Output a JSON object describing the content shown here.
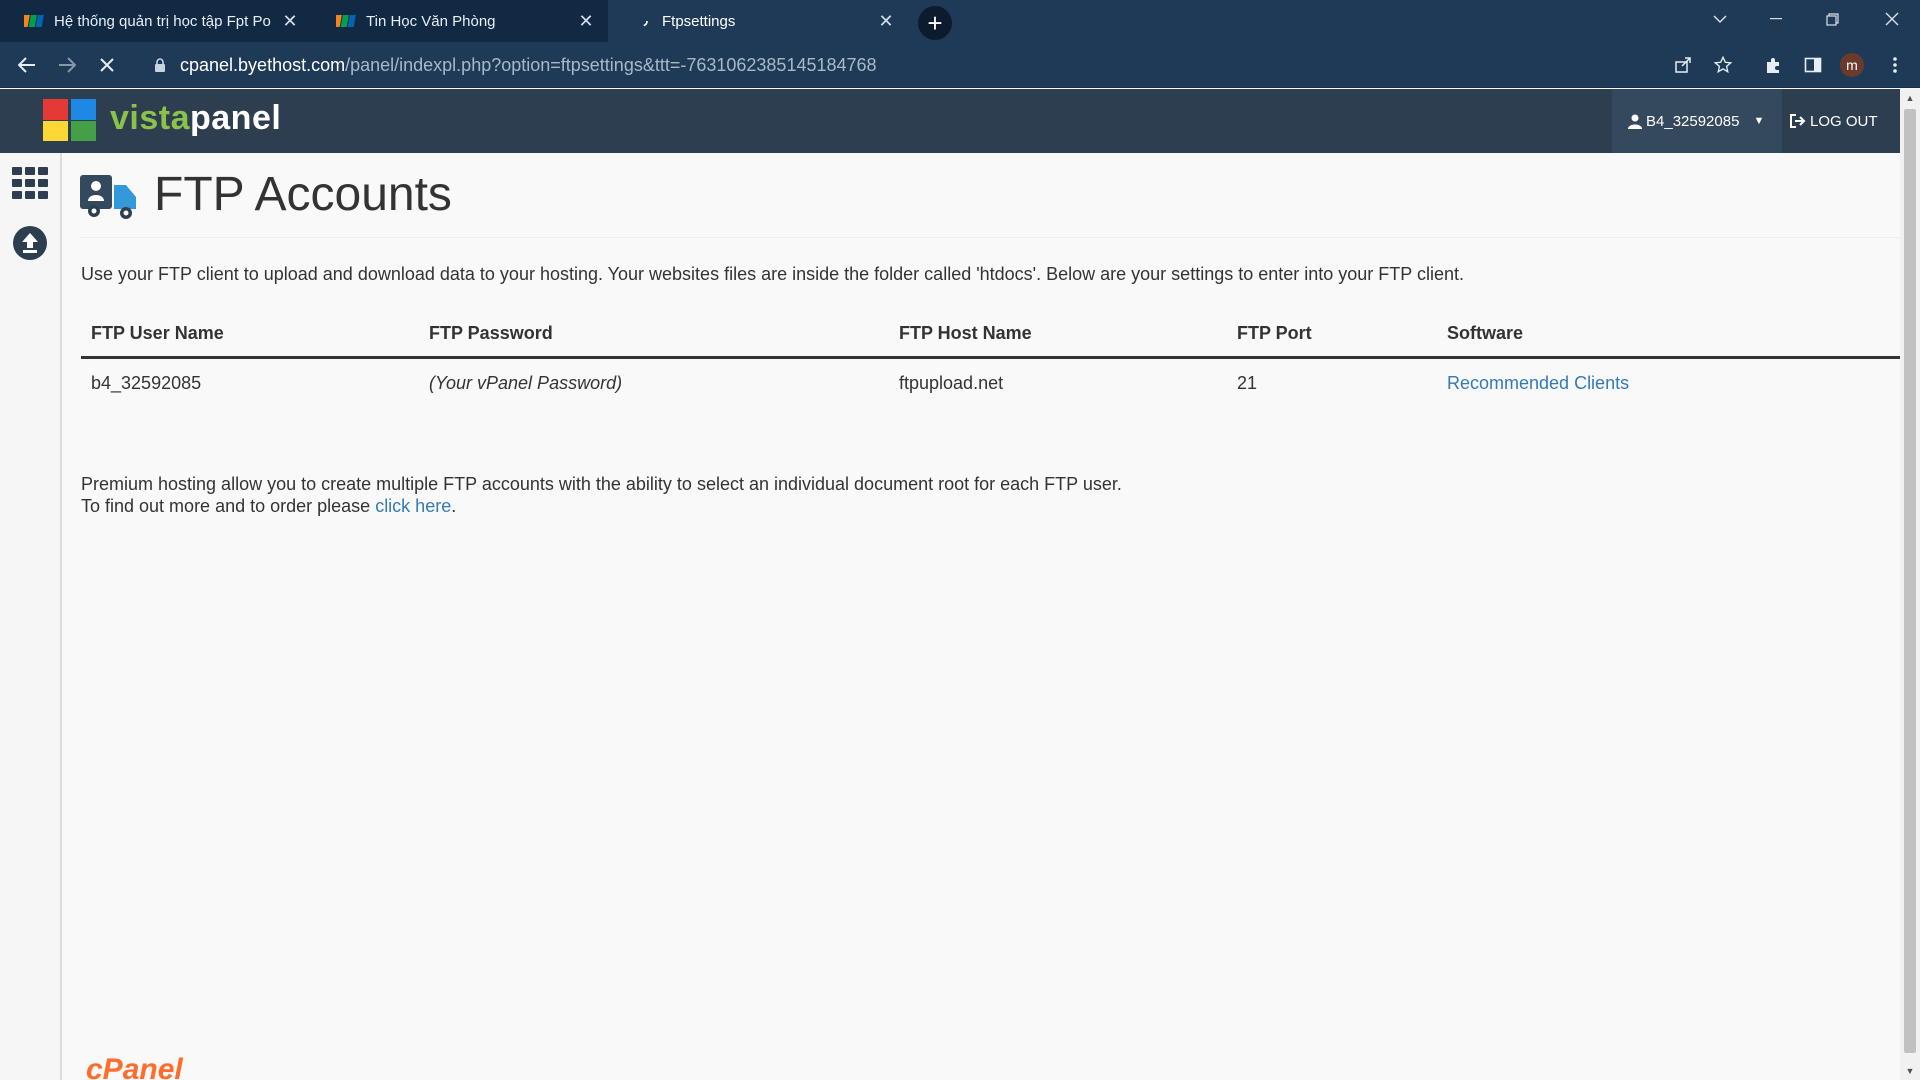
{
  "browser": {
    "tabs": [
      {
        "title": "Hệ thống quản trị học tập Fpt Po",
        "favicon": "fpt-logo-icon",
        "active": false
      },
      {
        "title": "Tin Học Văn Phòng",
        "favicon": "fpt-logo-icon",
        "active": false
      },
      {
        "title": "Ftpsettings",
        "favicon": "loading-icon",
        "active": true
      }
    ],
    "new_tab_label": "+",
    "url_host": "cpanel.byethost.com",
    "url_path": "/panel/indexpl.php?option=ftpsettings&ttt=-7631062385145184768",
    "profile_initial": "m"
  },
  "header": {
    "logo_part1": "vista",
    "logo_part2": "panel",
    "username": "B4_32592085",
    "logout_label": "LOG OUT"
  },
  "page": {
    "title": "FTP Accounts",
    "intro": "Use your FTP client to upload and download data to your hosting. Your websites files are inside the folder called 'htdocs'. Below are your settings to enter into your FTP client.",
    "table": {
      "headers": [
        "FTP User Name",
        "FTP Password",
        "FTP Host Name",
        "FTP Port",
        "Software"
      ],
      "row": {
        "username": "b4_32592085",
        "password": "(Your vPanel Password)",
        "host": "ftpupload.net",
        "port": "21",
        "software_link": "Recommended Clients"
      }
    },
    "premium_line1": "Premium hosting allow you to create multiple FTP accounts with the ability to select an individual document root for each FTP user.",
    "premium_line2_prefix": "To find out more and to order please ",
    "premium_link": "click here",
    "premium_line2_suffix": "."
  },
  "footer": {
    "brand": "cPanel"
  },
  "colors": {
    "browser_chrome": "#1f3a57",
    "header_bg": "#2c3e50",
    "link": "#337ab7",
    "logo_green": "#8bc34a"
  }
}
